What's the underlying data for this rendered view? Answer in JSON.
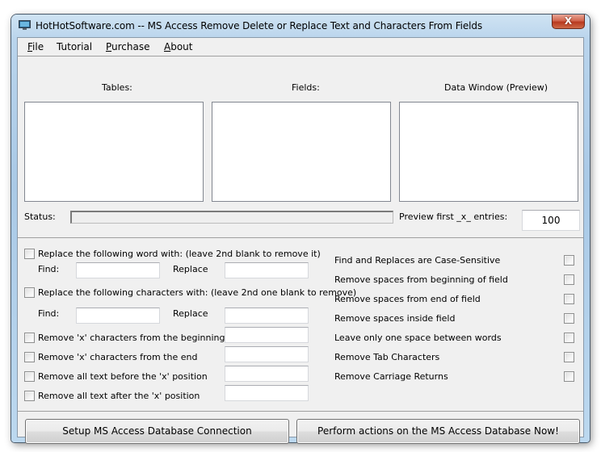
{
  "window": {
    "title": "HotHotSoftware.com -- MS Access Remove Delete or Replace Text and Characters From Fields",
    "close_label": "X",
    "icon": "monitor-icon"
  },
  "menu": {
    "items": [
      {
        "label": "File",
        "accel": "F"
      },
      {
        "label": "Tutorial",
        "accel": ""
      },
      {
        "label": "Purchase",
        "accel": "P"
      },
      {
        "label": "About",
        "accel": "A"
      }
    ]
  },
  "top": {
    "tables_label": "Tables:",
    "fields_label": "Fields:",
    "data_window_label": "Data Window (Preview)",
    "status_label": "Status:",
    "status_progress": 0,
    "preview_label": "Preview first _x_ entries:",
    "preview_value": "100"
  },
  "left_options": {
    "replace_word": {
      "label": "Replace the following word with: (leave 2nd blank to remove it)",
      "checked": false,
      "find_label": "Find:",
      "find_value": "",
      "replace_label": "Replace",
      "replace_value": ""
    },
    "replace_chars": {
      "label": "Replace the following characters with: (leave 2nd one blank to remove)",
      "checked": false,
      "find_label": "Find:",
      "find_value": "",
      "replace_label": "Replace",
      "replace_value": ""
    },
    "remove_options": [
      {
        "label": "Remove 'x' characters from the beginning",
        "checked": false,
        "value": ""
      },
      {
        "label": "Remove 'x' characters from the end",
        "checked": false,
        "value": ""
      },
      {
        "label": "Remove all text before the 'x' position",
        "checked": false,
        "value": ""
      },
      {
        "label": "Remove all text after the 'x' position",
        "checked": false,
        "value": ""
      }
    ]
  },
  "right_options": [
    {
      "label": "Find and Replaces are Case-Sensitive",
      "checked": false
    },
    {
      "label": "Remove spaces from beginning of field",
      "checked": false
    },
    {
      "label": "Remove spaces from end of field",
      "checked": false
    },
    {
      "label": "Remove spaces inside field",
      "checked": false
    },
    {
      "label": "Leave only one space between words",
      "checked": false
    },
    {
      "label": "Remove Tab Characters",
      "checked": false
    },
    {
      "label": "Remove Carriage Returns",
      "checked": false
    }
  ],
  "buttons": {
    "setup": "Setup MS Access Database Connection",
    "perform": "Perform actions on the MS Access Database Now!"
  }
}
